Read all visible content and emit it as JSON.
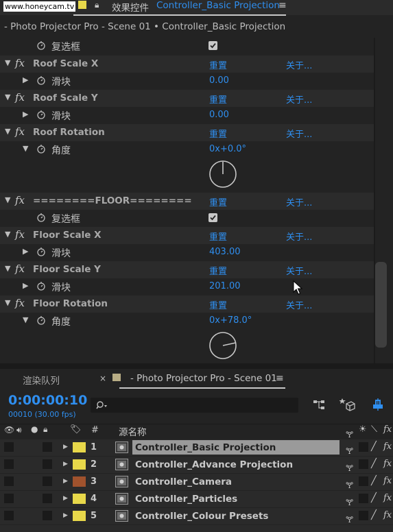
{
  "watermark": "www.honeycam.tv",
  "effect_controls": {
    "tab_label": "效果控件",
    "tab_target": "Controller_Basic Projection",
    "subtitle": "- Photo Projector Pro - Scene 01 • Controller_Basic Projection",
    "reset_label": "重置",
    "about_label": "关于...",
    "effects": [
      {
        "name": "Roof Scale X",
        "param": "滑块",
        "value": "0.00"
      },
      {
        "name": "Roof Scale Y",
        "param": "滑块",
        "value": "0.00"
      },
      {
        "name": "Roof Rotation",
        "param": "角度",
        "value": "0x+0.0°"
      },
      {
        "name": "========FLOOR========",
        "param": "复选框",
        "value": ""
      },
      {
        "name": "Floor Scale X",
        "param": "滑块",
        "value": "403.00"
      },
      {
        "name": "Floor Scale Y",
        "param": "滑块",
        "value": "201.00"
      },
      {
        "name": "Floor Rotation",
        "param": "角度",
        "value": "0x+78.0°"
      }
    ],
    "top_param": "复选框"
  },
  "timeline": {
    "render_queue_tab": "渲染队列",
    "comp_tab": "- Photo Projector Pro - Scene 01",
    "timecode": "0:00:00:10",
    "frames": "00010 (30.00 fps)",
    "search_placeholder": "",
    "col_num": "#",
    "col_source": "源名称",
    "layers": [
      {
        "num": "1",
        "name": "Controller_Basic Projection",
        "color": "#e8d84a",
        "selected": true
      },
      {
        "num": "2",
        "name": "Controller_Advance Projection",
        "color": "#e8d84a"
      },
      {
        "num": "3",
        "name": "Controller_Camera",
        "color": "#a0522d"
      },
      {
        "num": "4",
        "name": "Controller_Particles",
        "color": "#e8d84a"
      },
      {
        "num": "5",
        "name": "Controller_Colour Presets",
        "color": "#e8d84a"
      }
    ]
  },
  "colors": {
    "accent": "#2f8ff0",
    "panel": "#232323",
    "row": "#2b2b2b",
    "label_yellow": "#e8d84a"
  }
}
